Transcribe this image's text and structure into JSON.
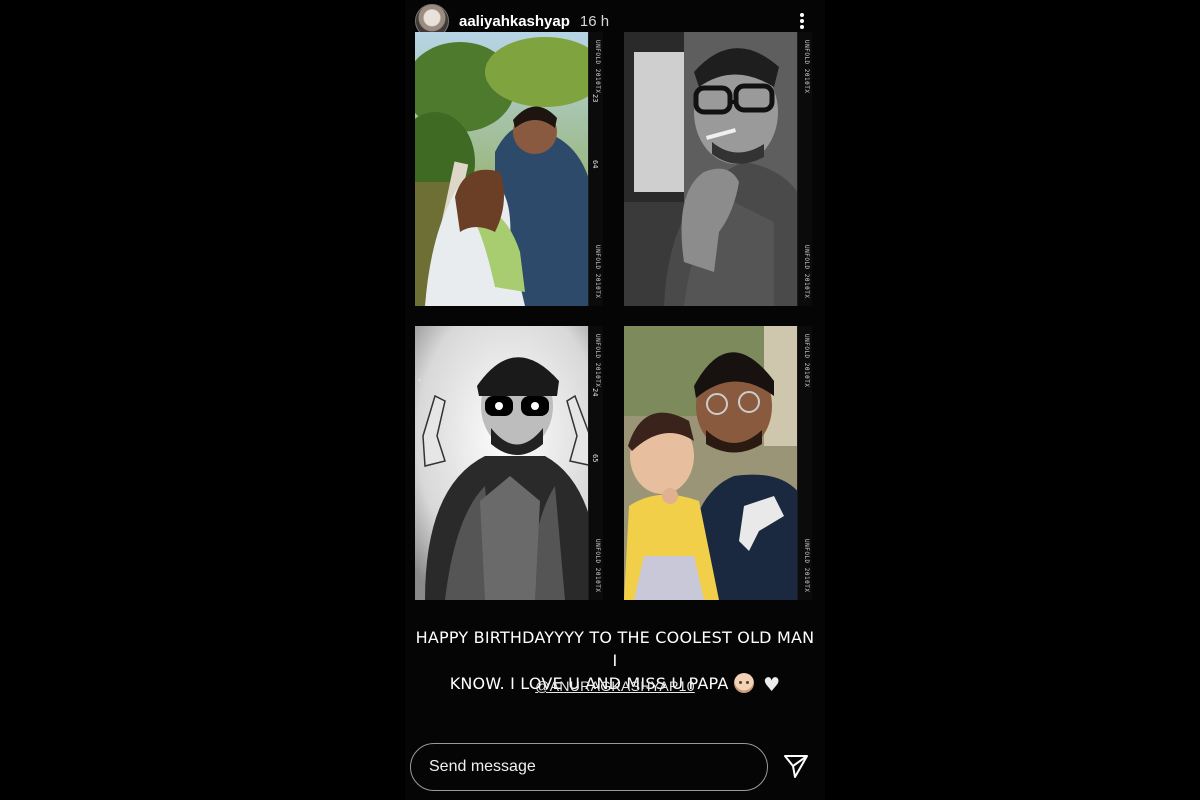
{
  "story": {
    "username": "aaliyahkashyap",
    "time_ago": "16 h",
    "caption_line1": "HAPPY BIRTHDAYYYY TO THE COOLEST OLD MAN I",
    "caption_line2": "KNOW. I LOVE U AND MISS U PAPA",
    "mention": "@ANURAGKASHYAP10"
  },
  "film": {
    "edge_text": "UNFOLD 2010TX",
    "frame_numbers": [
      "23",
      "64",
      "24",
      "65"
    ]
  },
  "composer": {
    "placeholder": "Send message"
  },
  "icons": {
    "avatar": "profile-avatar",
    "more": "more-vertical-icon",
    "send": "send-paper-plane-icon",
    "emoji1": "older-person-emoji",
    "emoji2": "white-heart-emoji"
  }
}
